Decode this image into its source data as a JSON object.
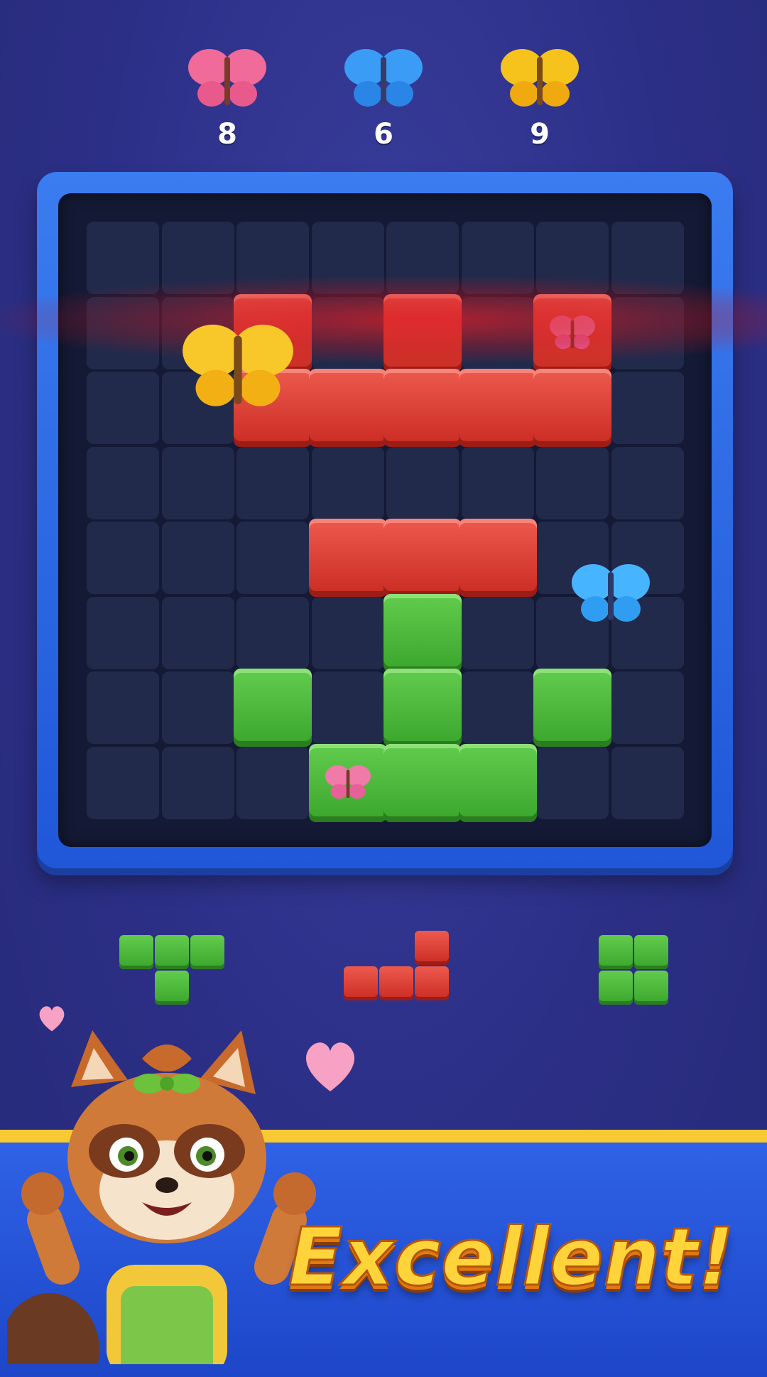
{
  "goals": [
    {
      "icon": "pink-butterfly-icon",
      "color": "#f06a9a",
      "count": "8"
    },
    {
      "icon": "blue-butterfly-icon",
      "color": "#3b9cf6",
      "count": "6"
    },
    {
      "icon": "yellow-butterfly-icon",
      "color": "#f6c21c",
      "count": "9"
    }
  ],
  "board": {
    "rows": 8,
    "cols": 8,
    "blocks": [
      {
        "row": 1,
        "col": 2,
        "color": "red"
      },
      {
        "row": 1,
        "col": 4,
        "color": "red"
      },
      {
        "row": 1,
        "col": 6,
        "color": "red",
        "butterfly": "pink"
      },
      {
        "row": 2,
        "col": 2,
        "color": "red"
      },
      {
        "row": 2,
        "col": 3,
        "color": "red"
      },
      {
        "row": 2,
        "col": 4,
        "color": "red"
      },
      {
        "row": 2,
        "col": 5,
        "color": "red"
      },
      {
        "row": 2,
        "col": 6,
        "color": "red"
      },
      {
        "row": 4,
        "col": 3,
        "color": "red"
      },
      {
        "row": 4,
        "col": 4,
        "color": "red"
      },
      {
        "row": 4,
        "col": 5,
        "color": "red"
      },
      {
        "row": 5,
        "col": 4,
        "color": "green"
      },
      {
        "row": 6,
        "col": 2,
        "color": "green"
      },
      {
        "row": 6,
        "col": 4,
        "color": "green"
      },
      {
        "row": 6,
        "col": 6,
        "color": "green"
      },
      {
        "row": 7,
        "col": 3,
        "color": "green",
        "butterfly": "pink"
      },
      {
        "row": 7,
        "col": 4,
        "color": "green"
      },
      {
        "row": 7,
        "col": 5,
        "color": "green"
      }
    ],
    "cleared_row": 3
  },
  "tray": [
    {
      "name": "t-piece",
      "color": "green",
      "cells": [
        [
          0,
          0
        ],
        [
          0,
          1
        ],
        [
          0,
          2
        ],
        [
          1,
          1
        ]
      ]
    },
    {
      "name": "l-piece",
      "color": "red",
      "cells": [
        [
          0,
          2
        ],
        [
          1,
          0
        ],
        [
          1,
          1
        ],
        [
          1,
          2
        ]
      ]
    },
    {
      "name": "square-piece",
      "color": "green",
      "cells": [
        [
          0,
          0
        ],
        [
          0,
          1
        ],
        [
          1,
          0
        ],
        [
          1,
          1
        ]
      ]
    }
  ],
  "banner": {
    "text": "Excellent!"
  },
  "colors": {
    "red": "#d9392e",
    "green": "#4cba3b",
    "frame": "#2a66e6",
    "banner_trim": "#f7c933"
  }
}
